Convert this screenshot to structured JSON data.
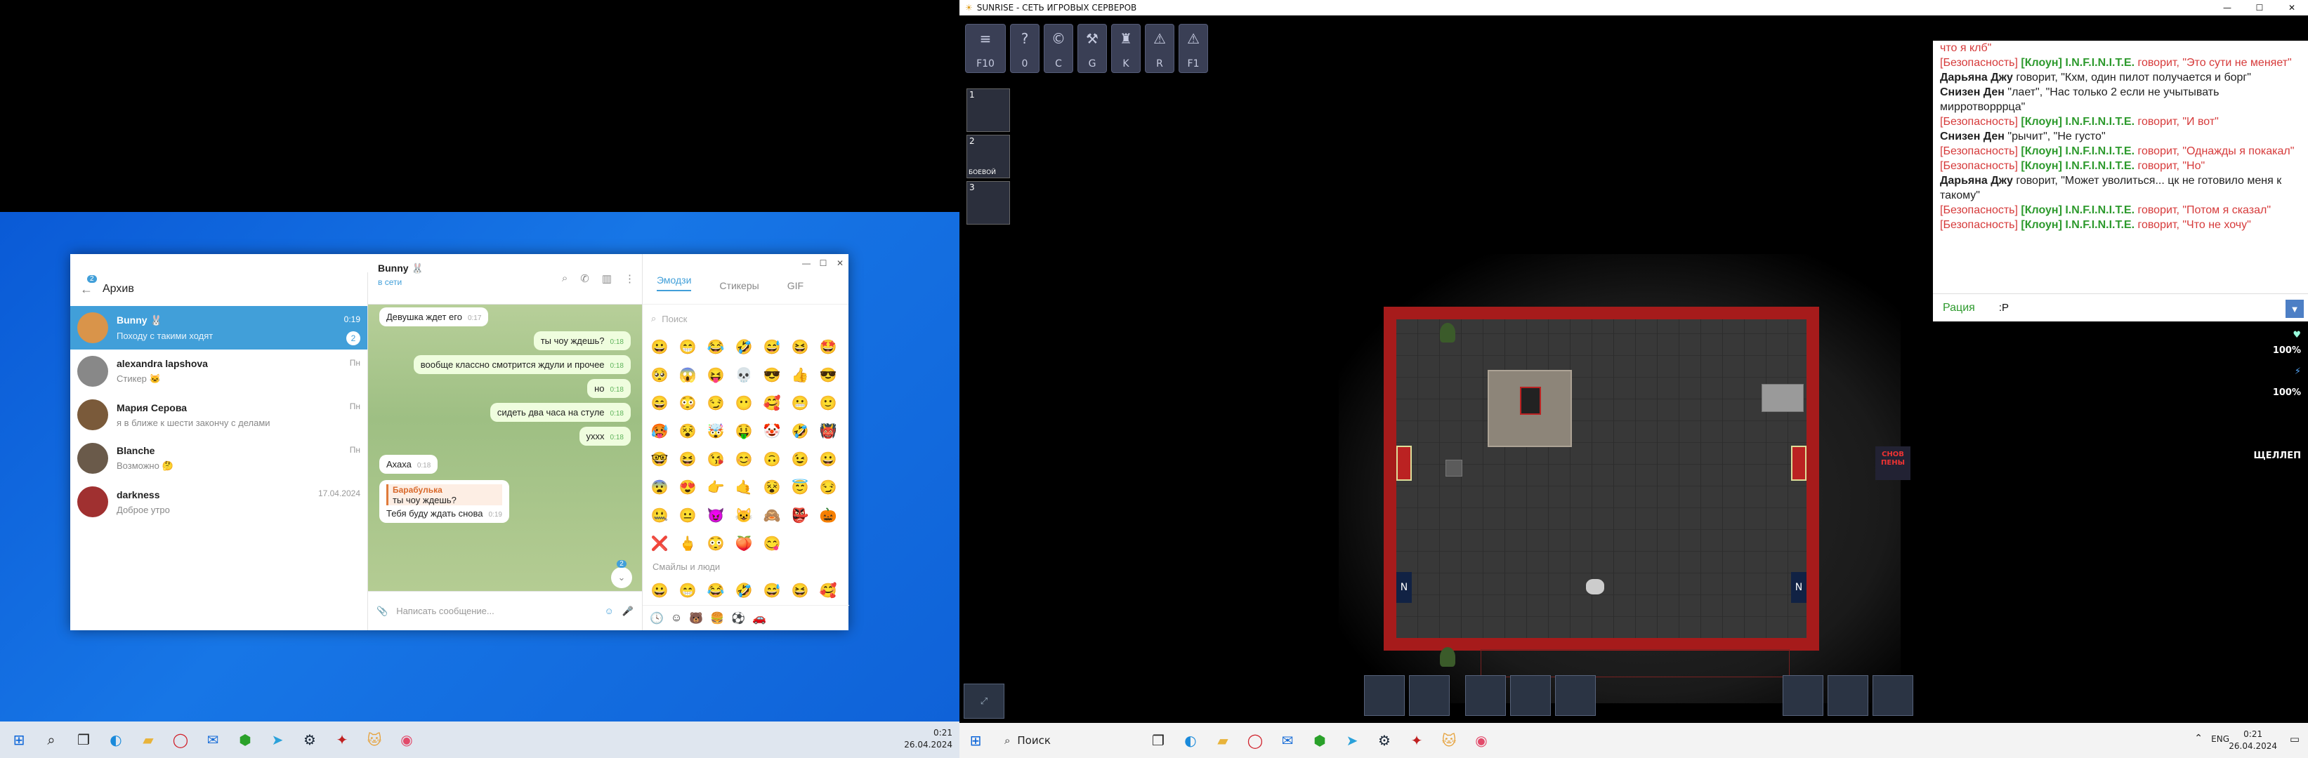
{
  "telegram": {
    "sidebar": {
      "title": "Архив",
      "archive_badge": "2",
      "chats": [
        {
          "name": "Bunny 🐰",
          "preview": "Походу с такими ходят",
          "time": "0:19",
          "unread": "2",
          "active": true,
          "avatar_color": "#d9944a"
        },
        {
          "name": "alexandra lapshova",
          "preview": "Стикер 🐱",
          "time": "Пн",
          "unread": "",
          "active": false,
          "avatar_color": "#888888"
        },
        {
          "name": "Мария Серова",
          "preview": "я в ближе к шести закончу с делами",
          "time": "Пн",
          "unread": "",
          "active": false,
          "avatar_color": "#7a5a3a"
        },
        {
          "name": "Blanche",
          "preview": "Возможно 🤔",
          "time": "Пн",
          "unread": "",
          "active": false,
          "avatar_color": "#6a5a4a"
        },
        {
          "name": "darkness",
          "preview": "Доброе утро",
          "time": "17.04.2024",
          "unread": "",
          "active": false,
          "avatar_color": "#a03030"
        }
      ]
    },
    "chat": {
      "title": "Bunny 🐰",
      "status": "в сети",
      "messages": [
        {
          "dir": "in",
          "text": "Девушка ждет его",
          "time": "0:17"
        },
        {
          "dir": "out",
          "text": "ты чоу ждешь?",
          "time": "0:18"
        },
        {
          "dir": "out",
          "text": "вообще классно смотрится ждули и прочее",
          "time": "0:18"
        },
        {
          "dir": "out",
          "text": "но",
          "time": "0:18"
        },
        {
          "dir": "out",
          "text": "сидеть два часа на стуле",
          "time": "0:18"
        },
        {
          "dir": "out",
          "text": "ухxx",
          "time": "0:18"
        },
        {
          "dir": "in",
          "text": "Ахаха",
          "time": "0:18"
        },
        {
          "dir": "in",
          "quote_name": "Барабулька",
          "quote_text": "ты чоу ждешь?",
          "text": "Тебя буду ждать снова",
          "time": "0:19"
        }
      ],
      "scroll_badge": "2",
      "input_placeholder": "Написать сообщение..."
    },
    "emoji_panel": {
      "tabs": [
        "Эмодзи",
        "Стикеры",
        "GIF"
      ],
      "search_placeholder": "Поиск",
      "emojis": [
        "😀",
        "😁",
        "😂",
        "🤣",
        "😅",
        "😆",
        "🤩",
        "🥺",
        "😱",
        "😝",
        "💀",
        "😎",
        "👍",
        "😎",
        "😄",
        "😳",
        "😏",
        "😶",
        "🥰",
        "😬",
        "🙂",
        "🥵",
        "😵",
        "🤯",
        "🤑",
        "🤡",
        "🤣",
        "👹",
        "🤓",
        "😆",
        "😘",
        "😊",
        "🙃",
        "😉",
        "😀",
        "😨",
        "😍",
        "👉",
        "🤙",
        "😵",
        "😇",
        "😏",
        "🤐",
        "😐",
        "😈",
        "😺",
        "🙈",
        "👺",
        "🎃",
        "❌",
        "🖕",
        "😳",
        "🍑",
        "😋"
      ],
      "section_label": "Смайлы и люди",
      "emojis2": [
        "😀",
        "😁",
        "😂",
        "🤣",
        "😅",
        "😆",
        "🥰"
      ]
    }
  },
  "left_taskbar": {
    "time": "0:21",
    "date": "26.04.2024"
  },
  "game": {
    "window_title": "SUNRISE - СЕТЬ ИГРОВЫХ СЕРВЕРОВ",
    "hud_buttons": [
      {
        "icon": "≡",
        "label": "F10"
      },
      {
        "icon": "?",
        "label": "0"
      },
      {
        "icon": "©",
        "label": "C"
      },
      {
        "icon": "⚒",
        "label": "G"
      },
      {
        "icon": "♜",
        "label": "K"
      },
      {
        "icon": "⚠",
        "label": "R"
      },
      {
        "icon": "⚠",
        "label": "F1"
      }
    ],
    "slots": [
      {
        "num": "1",
        "label": ""
      },
      {
        "num": "2",
        "label": "БОЕВОЙ"
      },
      {
        "num": "3",
        "label": ""
      }
    ],
    "chat_lines": [
      {
        "parts": [
          {
            "c": "red",
            "t": "что я клб\""
          }
        ]
      },
      {
        "parts": [
          {
            "c": "sec",
            "t": "[Безопасность] "
          },
          {
            "c": "clown",
            "t": "[Клоун] I.N.F.I.N.I.T.E."
          },
          {
            "c": "red",
            "t": " говорит, \"Это сути не меняет\""
          }
        ]
      },
      {
        "parts": [
          {
            "c": "nm",
            "t": "Дарьяна Джу"
          },
          {
            "c": "",
            "t": " говорит, \"Кхм, один пилот получается и борг\""
          }
        ]
      },
      {
        "parts": [
          {
            "c": "nm",
            "t": "Снизен Ден"
          },
          {
            "c": "",
            "t": " \"лает\", \"Нас только 2 если не учытывать мирротворррца\""
          }
        ]
      },
      {
        "parts": [
          {
            "c": "sec",
            "t": "[Безопасность] "
          },
          {
            "c": "clown",
            "t": "[Клоун] I.N.F.I.N.I.T.E."
          },
          {
            "c": "red",
            "t": " говорит, \"И вот\""
          }
        ]
      },
      {
        "parts": [
          {
            "c": "nm",
            "t": "Снизен Ден"
          },
          {
            "c": "",
            "t": " \"рычит\", \"Не густо\""
          }
        ]
      },
      {
        "parts": [
          {
            "c": "sec",
            "t": "[Безопасность] "
          },
          {
            "c": "clown",
            "t": "[Клоун] I.N.F.I.N.I.T.E."
          },
          {
            "c": "red",
            "t": " говорит, \"Однажды я покакал\""
          }
        ]
      },
      {
        "parts": [
          {
            "c": "sec",
            "t": "[Безопасность] "
          },
          {
            "c": "clown",
            "t": "[Клоун] I.N.F.I.N.I.T.E."
          },
          {
            "c": "red",
            "t": " говорит, \"Но\""
          }
        ]
      },
      {
        "parts": [
          {
            "c": "nm",
            "t": "Дарьяна Джу"
          },
          {
            "c": "",
            "t": " говорит, \"Может уволиться... цк не готовило меня к такому\""
          }
        ]
      },
      {
        "parts": [
          {
            "c": "sec",
            "t": "[Безопасность] "
          },
          {
            "c": "clown",
            "t": "[Клоун] I.N.F.I.N.I.T.E."
          },
          {
            "c": "red",
            "t": " говорит, \"Потом я сказал\""
          }
        ]
      },
      {
        "parts": [
          {
            "c": "sec",
            "t": "[Безопасность] "
          },
          {
            "c": "clown",
            "t": "[Клоун] I.N.F.I.N.I.T.E."
          },
          {
            "c": "red",
            "t": " говорит, \"Что не хочу\""
          }
        ]
      }
    ],
    "chat_channel": "Рация",
    "chat_input_value": ":P",
    "status": {
      "health": "100%",
      "energy": "100%",
      "mode": "ЩЕЛЛЕП"
    },
    "sign_text": "СНОВ ПЕНЫ"
  },
  "right_taskbar": {
    "search_label": "Поиск",
    "lang": "ENG",
    "time": "0:21",
    "date": "26.04.2024"
  },
  "colors": {
    "telegram_accent": "#419fd9",
    "security_red": "#d63a3a",
    "clown_green": "#2d9a2d",
    "room_wall": "#a61b1b"
  }
}
